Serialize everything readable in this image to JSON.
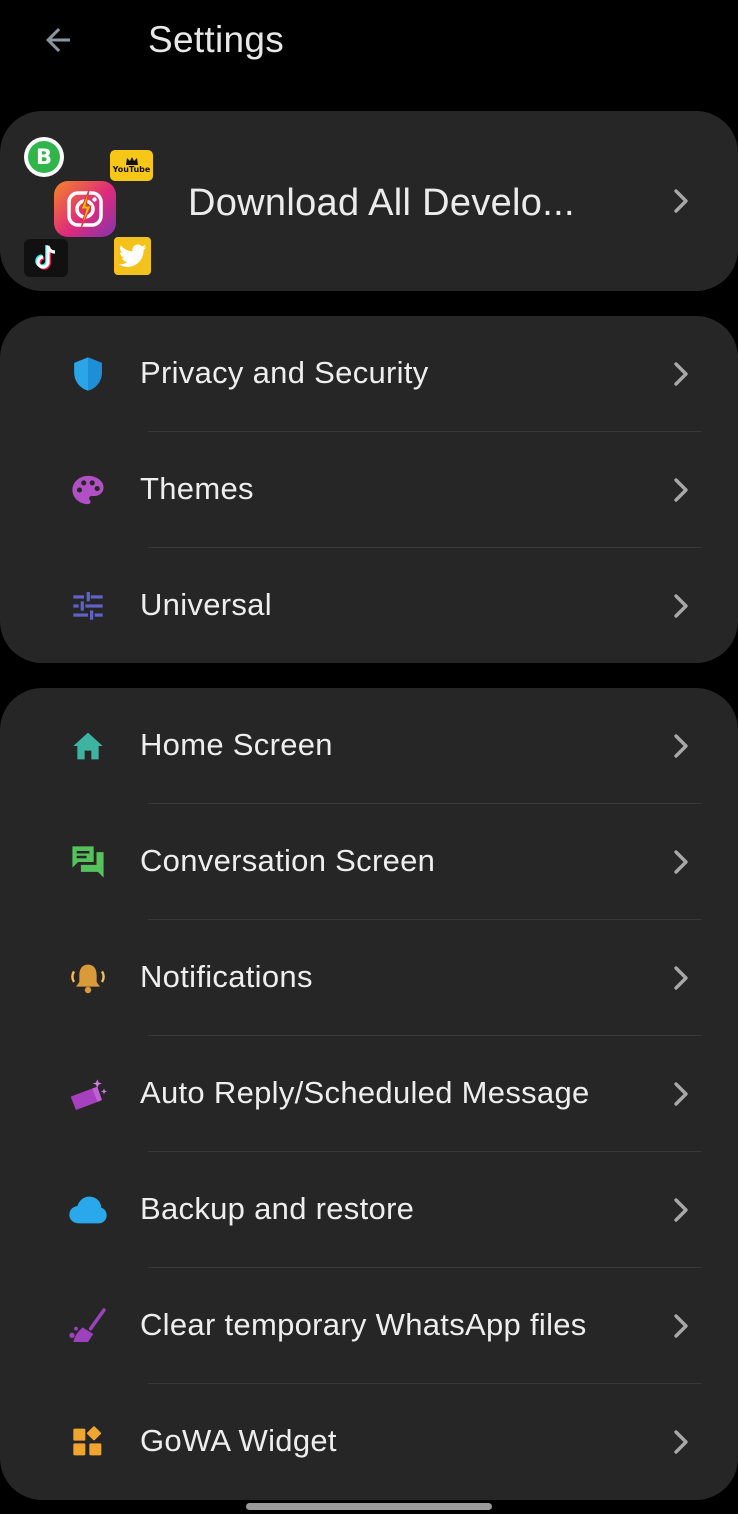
{
  "header": {
    "title": "Settings",
    "back_icon": "arrow-left-icon"
  },
  "promo": {
    "label": "Download All Develo...",
    "icons": {
      "whatsapp_business_letter": "B",
      "youtube_badge_text": "YouTube"
    }
  },
  "section_one": {
    "items": [
      {
        "label": "Privacy and Security",
        "icon": "shield-icon",
        "color": "#2ba4e8"
      },
      {
        "label": "Themes",
        "icon": "palette-icon",
        "color": "#b14fc4"
      },
      {
        "label": "Universal",
        "icon": "sliders-icon",
        "color": "#5f63c8"
      }
    ]
  },
  "section_two": {
    "items": [
      {
        "label": "Home Screen",
        "icon": "home-icon",
        "color": "#3fb3a1"
      },
      {
        "label": "Conversation Screen",
        "icon": "chat-icon",
        "color": "#56c25c"
      },
      {
        "label": "Notifications",
        "icon": "bell-icon",
        "color": "#d99a3a"
      },
      {
        "label": "Auto Reply/Scheduled Message",
        "icon": "magic-wand-icon",
        "color": "#a740c0"
      },
      {
        "label": "Backup and restore",
        "icon": "cloud-icon",
        "color": "#29a9ec"
      },
      {
        "label": "Clear temporary WhatsApp files",
        "icon": "broom-icon",
        "color": "#9c42bd"
      },
      {
        "label": "GoWA Widget",
        "icon": "widget-icon",
        "color": "#f1a531"
      }
    ]
  },
  "colors": {
    "background": "#000000",
    "card": "#262626",
    "divider": "#383838",
    "chevron": "#a8a8a8"
  }
}
